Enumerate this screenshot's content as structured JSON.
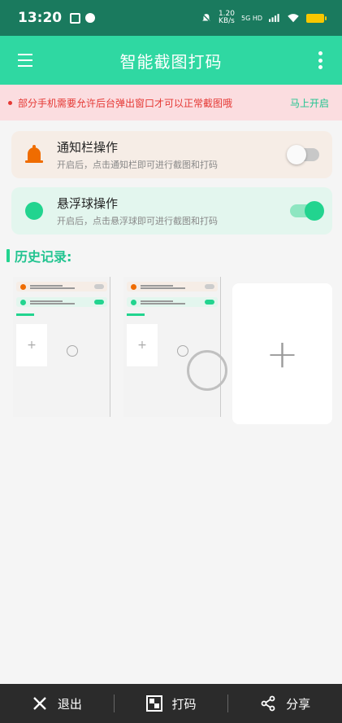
{
  "status_bar": {
    "time": "13:20",
    "net_speed_top": "1.20",
    "net_speed_bottom": "KB/s",
    "network": "5G HD"
  },
  "app_bar": {
    "title": "智能截图打码"
  },
  "notice": {
    "message": "部分手机需要允许后台弹出窗口才可以正常截图哦",
    "action": "马上开启"
  },
  "cards": [
    {
      "title": "通知栏操作",
      "subtitle": "开启后，点击通知栏即可进行截图和打码",
      "enabled": false
    },
    {
      "title": "悬浮球操作",
      "subtitle": "开启后，点击悬浮球即可进行截图和打码",
      "enabled": true
    }
  ],
  "history": {
    "label": "历史记录:",
    "add_symbol": "+"
  },
  "bottom_bar": {
    "exit_label": "退出",
    "mosaic_label": "打码",
    "share_label": "分享"
  },
  "colors": {
    "status_bar": "#1a7a5e",
    "primary": "#2fd8a2",
    "accent_text": "#22c490",
    "warning": "#e53935",
    "bell": "#ef6c00",
    "bottom_bar": "#2b2b2b"
  }
}
